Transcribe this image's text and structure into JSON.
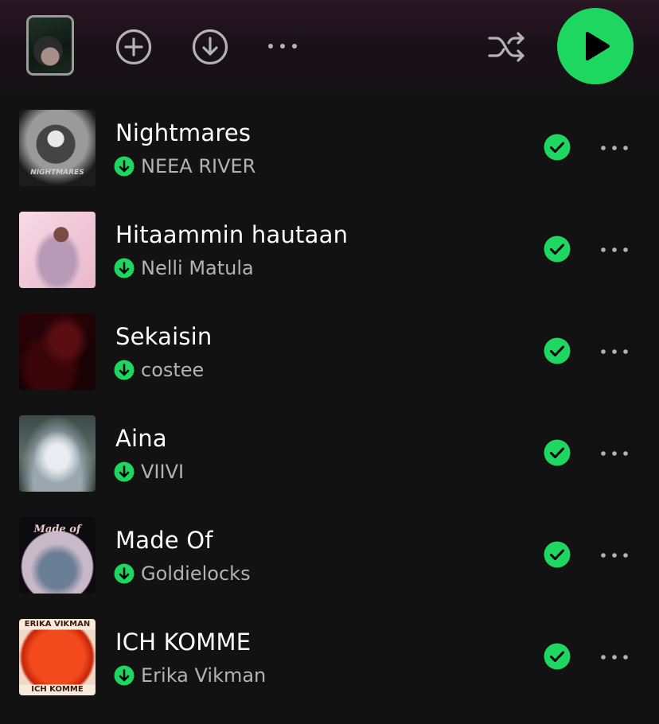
{
  "colors": {
    "accent": "#1ed760",
    "background": "#121212",
    "secondary_text": "#b3b3b3"
  },
  "toolbar": {
    "cover_icon": "playlist-cover",
    "add_icon": "plus-circle-icon",
    "download_icon": "download-circle-icon",
    "more_icon": "more-horizontal-icon",
    "shuffle_icon": "shuffle-icon",
    "play_icon": "play-icon"
  },
  "tracks": [
    {
      "title": "Nightmares",
      "artist": "NEEA RIVER",
      "downloaded": true,
      "added": true
    },
    {
      "title": "Hitaammin hautaan",
      "artist": "Nelli Matula",
      "downloaded": true,
      "added": true
    },
    {
      "title": "Sekaisin",
      "artist": "costee",
      "downloaded": true,
      "added": true
    },
    {
      "title": "Aina",
      "artist": "VIIVI",
      "downloaded": true,
      "added": true
    },
    {
      "title": "Made Of",
      "artist": "Goldielocks",
      "downloaded": true,
      "added": true
    },
    {
      "title": "ICH KOMME",
      "artist": "Erika Vikman",
      "downloaded": true,
      "added": true
    }
  ],
  "cover_art_text": {
    "nightmares": "NIGHTMARES",
    "made_of": "Made of",
    "ich_komme_top": "ERIKA   VIKMAN",
    "ich_komme_bottom": "ICH      KOMME"
  }
}
